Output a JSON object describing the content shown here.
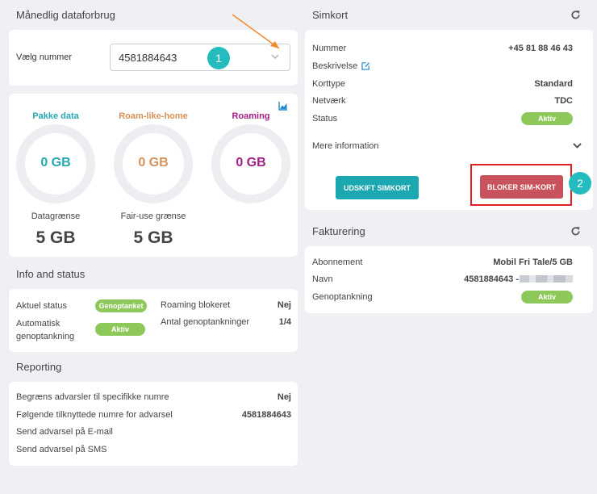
{
  "usage": {
    "title": "Månedlig dataforbrug",
    "select_label": "Vælg nummer",
    "selected_number": "4581884643",
    "annotation_1": "1",
    "gauges": [
      {
        "label": "Pakke data",
        "value": "0 GB",
        "color": "#25a9b2"
      },
      {
        "label": "Roam-like-home",
        "value": "0 GB",
        "color": "#d6925a"
      },
      {
        "label": "Roaming",
        "value": "0 GB",
        "color": "#a51e85"
      }
    ],
    "limits": [
      {
        "label": "Datagrænse",
        "value": "5 GB"
      },
      {
        "label": "Fair-use grænse",
        "value": "5 GB"
      }
    ]
  },
  "info": {
    "title": "Info and status",
    "current_status_label": "Aktuel status",
    "current_status_value": "Genoptanket",
    "auto_topup_label_1": "Automatisk",
    "auto_topup_label_2": "genoptankning",
    "auto_topup_value": "Aktiv",
    "roaming_blocked_label": "Roaming blokeret",
    "roaming_blocked_value": "Nej",
    "topups_label": "Antal genoptankninger",
    "topups_value": "1/4"
  },
  "reporting": {
    "title": "Reporting",
    "rows": [
      {
        "label": "Begræns advarsler til specifikke numre",
        "value": "Nej"
      },
      {
        "label": "Følgende tilknyttede numre for advarsel",
        "value": "4581884643"
      },
      {
        "label": "Send advarsel på E-mail",
        "value": ""
      },
      {
        "label": "Send advarsel på SMS",
        "value": ""
      }
    ]
  },
  "simcard": {
    "title": "Simkort",
    "number_label": "Nummer",
    "number_value": "+45 81 88 46 43",
    "description_label": "Beskrivelse",
    "type_label": "Korttype",
    "type_value": "Standard",
    "network_label": "Netværk",
    "network_value": "TDC",
    "status_label": "Status",
    "status_value": "Aktiv",
    "more_info": "Mere information",
    "replace_button": "UDSKIFT SIMKORT",
    "block_button": "BLOKER SIM-KORT",
    "annotation_2": "2"
  },
  "billing": {
    "title": "Fakturering",
    "subscription_label": "Abonnement",
    "subscription_value": "Mobil Fri Tale/5 GB",
    "name_label": "Navn",
    "name_value": "4581884643 -",
    "topup_label": "Genoptankning",
    "topup_value": "Aktiv"
  },
  "colors": {
    "accent_teal": "#1ba8b1",
    "danger_red": "#c8535c",
    "status_green": "#8ec85a",
    "annotation_orange": "#f08a2e",
    "annotation_box": "#e02020"
  }
}
